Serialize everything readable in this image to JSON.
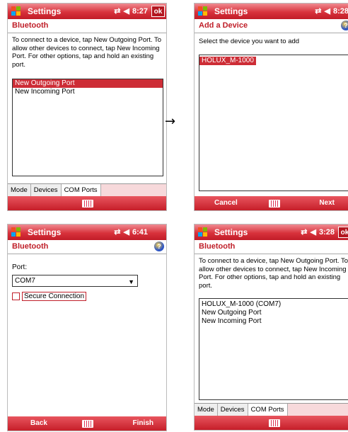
{
  "arrow": "→",
  "screen1": {
    "title": "Settings",
    "time": "8:27",
    "ok": "ok",
    "header": "Bluetooth",
    "description": "To connect to a device, tap New Outgoing Port. To allow other devices to connect, tap New Incoming Port. For other options, tap and hold an existing port.",
    "ports": [
      "New Outgoing Port",
      "New Incoming Port"
    ],
    "tabs": [
      "Mode",
      "Devices",
      "COM Ports"
    ]
  },
  "screen2": {
    "title": "Settings",
    "time": "8:28",
    "header": "Add a Device",
    "prompt": "Select the device you want to add",
    "devices": [
      "HOLUX_M-1000"
    ],
    "left_softkey": "Cancel",
    "right_softkey": "Next"
  },
  "screen3": {
    "title": "Settings",
    "time": "6:41",
    "header": "Bluetooth",
    "port_label": "Port:",
    "port_value": "COM7",
    "secure_label": "Secure Connection",
    "left_softkey": "Back",
    "right_softkey": "Finish"
  },
  "screen4": {
    "title": "Settings",
    "time": "3:28",
    "ok": "ok",
    "header": "Bluetooth",
    "description": "To connect to a device, tap New Outgoing Port. To allow other devices to connect, tap New Incoming Port. For other options, tap and hold an existing port.",
    "ports": [
      "HOLUX_M-1000 (COM7)",
      "New Outgoing Port",
      "New Incoming Port"
    ],
    "tabs": [
      "Mode",
      "Devices",
      "COM Ports"
    ]
  },
  "colors": {
    "accent": "#c0202a",
    "selection": "#cd2d36"
  }
}
